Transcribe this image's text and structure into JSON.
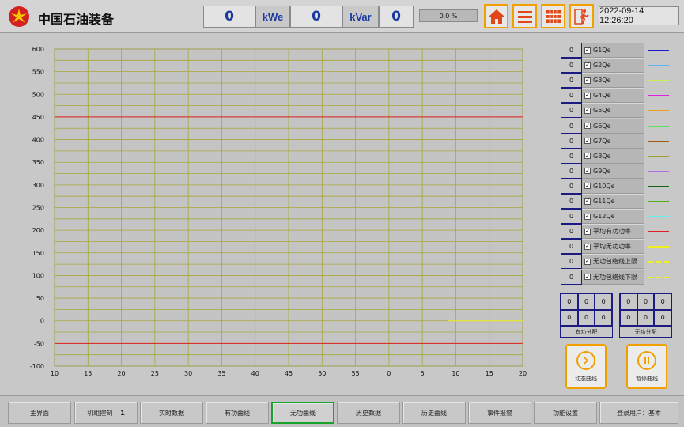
{
  "header": {
    "title": "中国石油装备",
    "active_power": "0",
    "active_power_unit": "kWe",
    "reactive_power": "0",
    "reactive_power_unit": "kVar",
    "extra_value": "0",
    "progress": "0.0 %",
    "datetime": "2022-09-14 12:26:20",
    "nav_icons": [
      "home-icon",
      "menu-icon",
      "grid-icon",
      "exit-run-icon"
    ],
    "accent_color": "#f2a000"
  },
  "legend": [
    {
      "value": "0",
      "checked": true,
      "label": "G1Qe",
      "color": "#1a1ad0",
      "dashed": false
    },
    {
      "value": "0",
      "checked": true,
      "label": "G2Qe",
      "color": "#5ab4f0",
      "dashed": false
    },
    {
      "value": "0",
      "checked": true,
      "label": "G3Qe",
      "color": "#c8f050",
      "dashed": false
    },
    {
      "value": "0",
      "checked": true,
      "label": "G4Qe",
      "color": "#e020e0",
      "dashed": false
    },
    {
      "value": "0",
      "checked": true,
      "label": "G5Qe",
      "color": "#f0a020",
      "dashed": false
    },
    {
      "value": "0",
      "checked": true,
      "label": "G6Qe",
      "color": "#60e060",
      "dashed": false
    },
    {
      "value": "0",
      "checked": true,
      "label": "G7Qe",
      "color": "#a05a10",
      "dashed": false
    },
    {
      "value": "0",
      "checked": true,
      "label": "G8Qe",
      "color": "#a0a030",
      "dashed": false
    },
    {
      "value": "0",
      "checked": true,
      "label": "G9Qe",
      "color": "#b070e0",
      "dashed": false
    },
    {
      "value": "0",
      "checked": true,
      "label": "G10Qe",
      "color": "#106010",
      "dashed": false
    },
    {
      "value": "0",
      "checked": true,
      "label": "G11Qe",
      "color": "#50b010",
      "dashed": false
    },
    {
      "value": "0",
      "checked": true,
      "label": "G12Qe",
      "color": "#60f0f0",
      "dashed": false
    },
    {
      "value": "0",
      "checked": true,
      "label": "平均有功功率",
      "color": "#e02020",
      "dashed": false
    },
    {
      "value": "0",
      "checked": true,
      "label": "平均无功功率",
      "color": "#f0f020",
      "dashed": false
    },
    {
      "value": "0",
      "checked": true,
      "label": "无功包络线上限",
      "color": "#f0f020",
      "dashed": true
    },
    {
      "value": "0",
      "checked": true,
      "label": "无功包络线下限",
      "color": "#f0f020",
      "dashed": true
    }
  ],
  "distribution": {
    "active": {
      "cells": [
        "0",
        "0",
        "0",
        "0",
        "0",
        "0"
      ],
      "label": "有功分配"
    },
    "reactive": {
      "cells": [
        "0",
        "0",
        "0",
        "0",
        "0",
        "0"
      ],
      "label": "无功分配"
    }
  },
  "actions": {
    "dynamic_label": "动态曲线",
    "pause_label": "暂停曲线"
  },
  "bottom_nav": {
    "tabs": [
      "主界面",
      "机组控制",
      "实时数据",
      "有功曲线",
      "无功曲线",
      "历史数据",
      "历史曲线",
      "事件报警",
      "功能设置",
      "登录用户：基本"
    ],
    "unit_number": "1",
    "active_index": 4,
    "active_color": "#1aa32a"
  },
  "chart_data": {
    "type": "line",
    "xlim": [
      10,
      20
    ],
    "ylim": [
      -100,
      600
    ],
    "x_tick_labels": [
      "10",
      "15",
      "20",
      "25",
      "30",
      "35",
      "40",
      "45",
      "50",
      "55",
      "0",
      "5",
      "10",
      "15",
      "20"
    ],
    "y_ticks": [
      600,
      550,
      500,
      450,
      400,
      350,
      300,
      250,
      200,
      150,
      100,
      50,
      0,
      -50,
      -100
    ],
    "y_minor_step": 25,
    "grid": true,
    "series": [
      {
        "name": "平均有功功率",
        "color": "#e02020",
        "style": "hline",
        "y": 450
      },
      {
        "name": "平均有功功率",
        "color": "#e02020",
        "style": "hline",
        "y": -50
      },
      {
        "name": "平均无功功率",
        "color": "#f0f020",
        "style": "segment",
        "x": [
          18.4,
          20
        ],
        "y": [
          0,
          0
        ]
      }
    ]
  }
}
